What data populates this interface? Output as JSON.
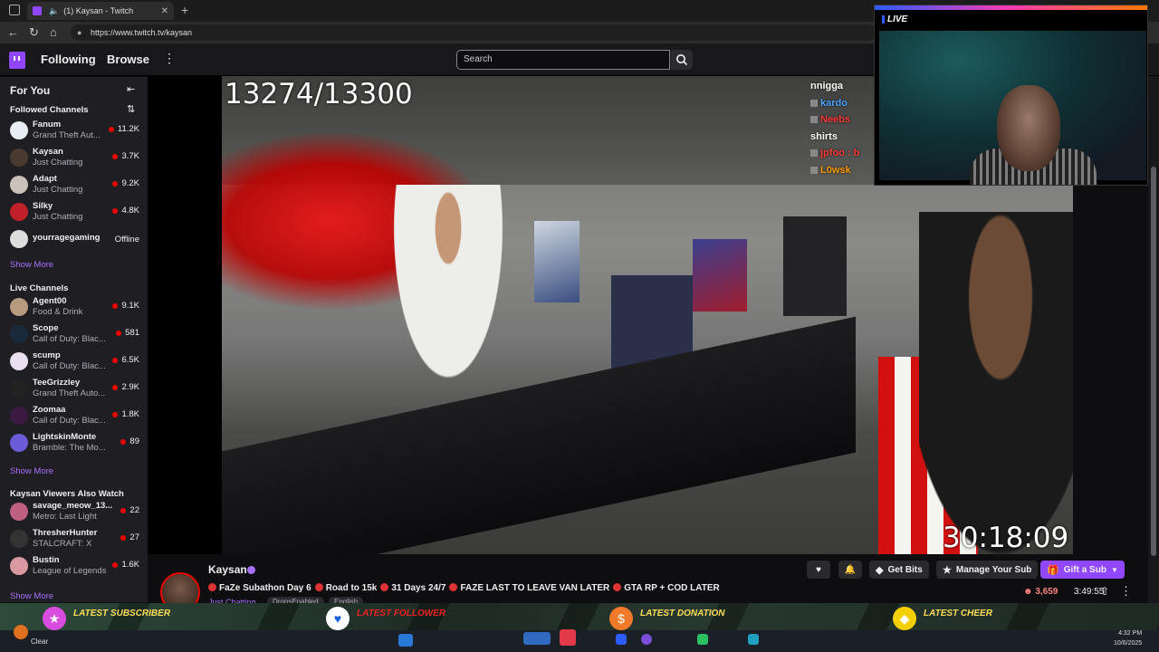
{
  "browser": {
    "tab_title": "(1) Kaysan - Twitch",
    "url": "https://www.twitch.tv/kaysan"
  },
  "topnav": {
    "following": "Following",
    "browse": "Browse",
    "search_placeholder": "Search"
  },
  "sidebar": {
    "for_you": "For You",
    "followed_header": "Followed Channels",
    "followed": [
      {
        "name": "Fanum",
        "game": "Grand Theft Aut...",
        "viewers": "11.2K",
        "color": "#e9eef5"
      },
      {
        "name": "Kaysan",
        "game": "Just Chatting",
        "viewers": "3.7K",
        "color": "#4a3a30"
      },
      {
        "name": "Adapt",
        "game": "Just Chatting",
        "viewers": "9.2K",
        "color": "#c9c2b8"
      },
      {
        "name": "Silky",
        "game": "Just Chatting",
        "viewers": "4.8K",
        "color": "#c0202a"
      },
      {
        "name": "yourragegaming",
        "game": "",
        "viewers": "Offline",
        "color": "#dddddd"
      }
    ],
    "show_more": "Show More",
    "live_header": "Live Channels",
    "live": [
      {
        "name": "Agent00",
        "game": "Food & Drink",
        "viewers": "9.1K",
        "color": "#b89a80"
      },
      {
        "name": "Scope",
        "game": "Call of Duty: Blac...",
        "viewers": "581",
        "color": "#1b2a3a"
      },
      {
        "name": "scump",
        "game": "Call of Duty: Blac...",
        "viewers": "6.5K",
        "color": "#e8e0f0"
      },
      {
        "name": "TeeGrizzley",
        "game": "Grand Theft Auto...",
        "viewers": "2.9K",
        "color": "#222"
      },
      {
        "name": "Zoomaa",
        "game": "Call of Duty: Blac...",
        "viewers": "1.8K",
        "color": "#3a1a40"
      },
      {
        "name": "LightskinMonte",
        "game": "Bramble: The Mo...",
        "viewers": "89",
        "color": "#6b5bd6"
      }
    ],
    "also_header": "Kaysan Viewers Also Watch",
    "also": [
      {
        "name": "savage_meow_13...",
        "game": "Metro: Last Light",
        "viewers": "22",
        "color": "#c06080"
      },
      {
        "name": "ThresherHunter",
        "game": "STALCRAFT: X",
        "viewers": "27",
        "color": "#333"
      },
      {
        "name": "Bustin",
        "game": "League of Legends",
        "viewers": "1.6K",
        "color": "#d89aa0"
      }
    ]
  },
  "video": {
    "counter": "13274/13300",
    "timer": "30:18:09",
    "chat": [
      {
        "text": "nnigga",
        "color": "white"
      },
      {
        "text": "kardo",
        "color": "blue"
      },
      {
        "text": "Neebs",
        "color": "red"
      },
      {
        "text": "shirts",
        "color": "white"
      },
      {
        "text": "jpfoo : b",
        "color": "red"
      },
      {
        "text": "L0wsk",
        "color": "orange"
      }
    ],
    "webcam_live": "LIVE"
  },
  "channel": {
    "name": "Kaysan",
    "title": "FaZe Subathon Day 6 • Road to 15k • 31 Days 24/7 •FAZE LAST TO LEAVE VAN LATER• GTA RP + COD LATER",
    "title_segments": [
      "FaZe Subathon Day 6",
      "Road to 15k",
      "31 Days 24/7",
      "FAZE LAST TO LEAVE VAN LATER",
      "GTA RP + COD LATER"
    ],
    "game": "Just Chatting",
    "tags": [
      "DropsEnabled",
      "English"
    ],
    "viewers": "3,659",
    "uptime": "3:49:55",
    "get_bits": "Get Bits",
    "manage_sub": "Manage Your Sub",
    "gift_sub": "Gift a Sub"
  },
  "alerts": {
    "subscriber": "LATEST SUBSCRIBER",
    "follower": "LATEST FOLLOWER",
    "donation": "LATEST DONATION",
    "cheer": "LATEST CHEER"
  },
  "taskbar": {
    "weather": "Clear",
    "time": "4:32 PM",
    "date": "10/6/2025"
  }
}
